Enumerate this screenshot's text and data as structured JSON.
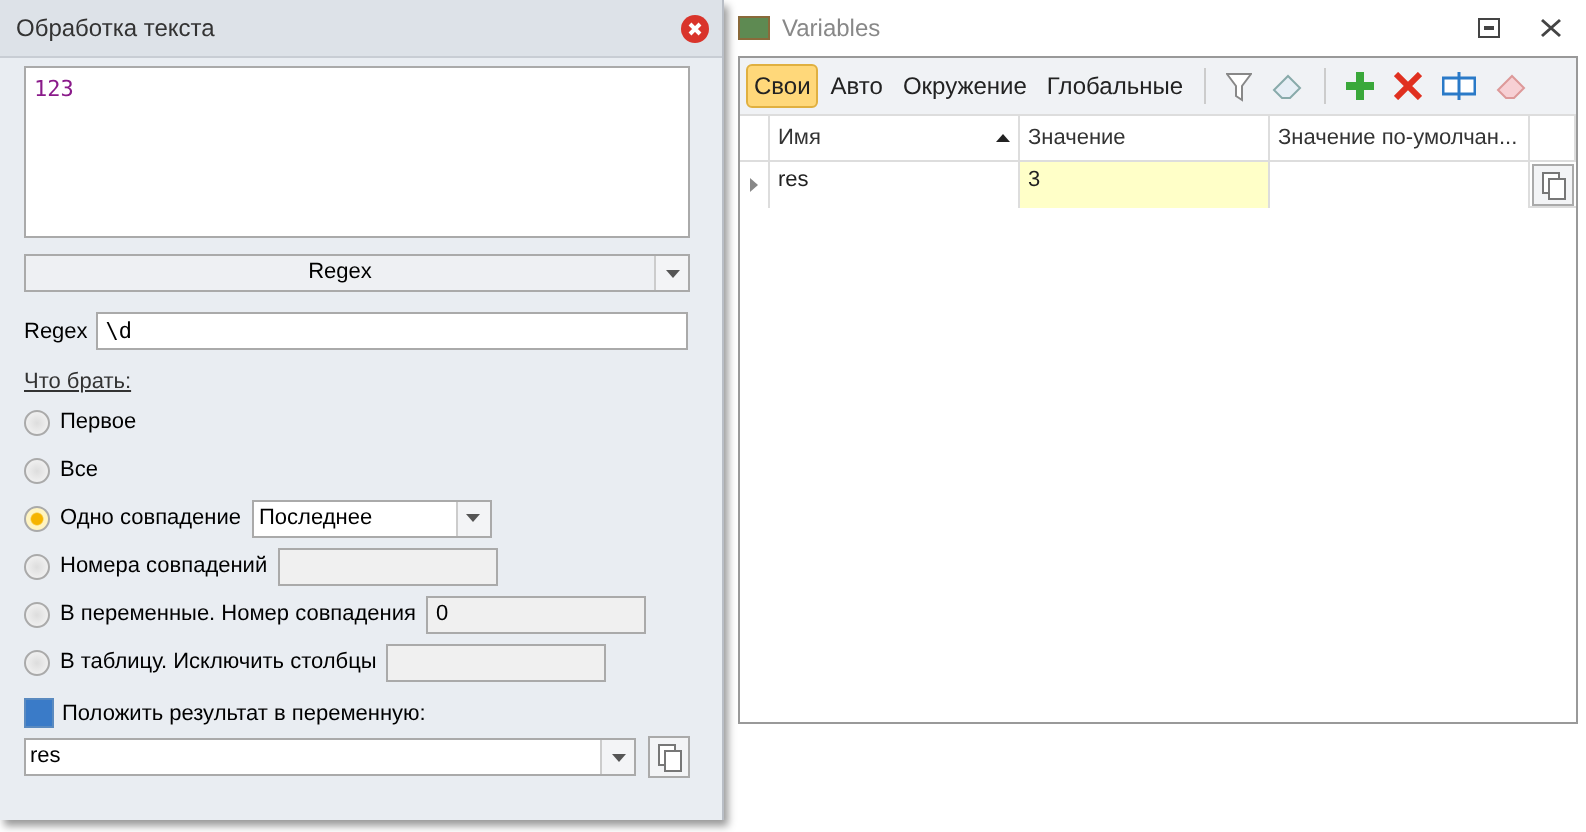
{
  "panel": {
    "title": "Обработка текста",
    "text": "123",
    "mode": "Regex",
    "regex_label": "Regex",
    "regex": "\\d",
    "what_label": "Что брать:",
    "options": [
      {
        "kind": "plain",
        "label": "Первое",
        "selected": false
      },
      {
        "kind": "plain",
        "label": "Все",
        "selected": false
      },
      {
        "kind": "combo",
        "label": "Одно совпадение",
        "value": "Последнее",
        "selected": true
      },
      {
        "kind": "field",
        "label": "Номера совпадений",
        "selected": false
      },
      {
        "kind": "field",
        "label": "В переменные. Номер совпадения",
        "value": "0",
        "selected": false
      },
      {
        "kind": "field",
        "label": "В таблицу. Исключить столбцы",
        "selected": false
      }
    ],
    "save_label": "Положить результат в переменную:",
    "save_checked": true,
    "variable": "res"
  },
  "variables": {
    "title": "Variables",
    "tabs": [
      {
        "label": "Свои",
        "selected": true
      },
      {
        "label": "Авто",
        "selected": false
      },
      {
        "label": "Окружение",
        "selected": false
      },
      {
        "label": "Глобальные",
        "selected": false
      }
    ],
    "columns": [
      "Имя",
      "Значение",
      "Значение по-умолчан..."
    ],
    "rows": [
      {
        "name": "res",
        "value": "3",
        "default": ""
      }
    ]
  }
}
